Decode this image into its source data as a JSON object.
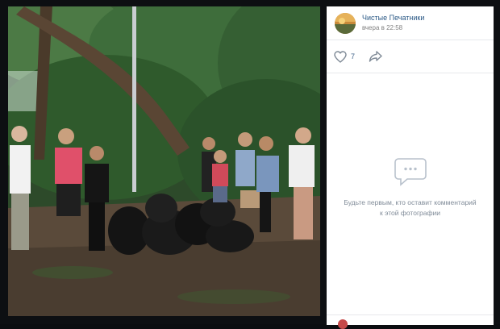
{
  "post": {
    "author": "Чистые Печатники",
    "time": "вчера в 22:58",
    "likes": "7"
  },
  "comments": {
    "empty_text": "Будьте первым, кто оставит комментарий к этой фотографии"
  },
  "icons": {
    "like": "heart-icon",
    "share": "share-arrow-icon",
    "empty": "chat-bubble-icon"
  },
  "colors": {
    "link": "#2a5885",
    "muted": "#818c99",
    "background": "#0d0f12"
  }
}
